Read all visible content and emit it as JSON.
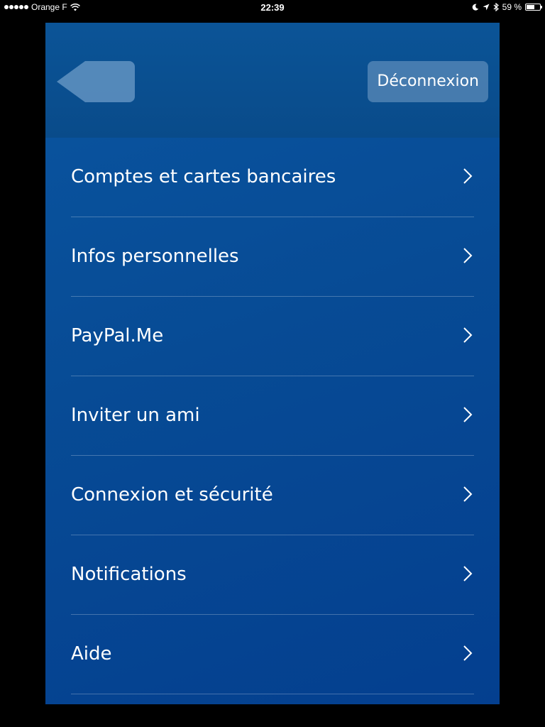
{
  "status_bar": {
    "carrier": "Orange F",
    "time": "22:39",
    "battery_text": "59 %",
    "battery_level": 0.59,
    "icons": [
      "signal-dots-icon",
      "wifi-icon",
      "moon-icon",
      "location-arrow-icon",
      "bluetooth-icon",
      "battery-icon"
    ]
  },
  "header": {
    "back_icon": "back-arrow-icon",
    "logout_label": "Déconnexion"
  },
  "menu": {
    "items": [
      {
        "label": "Comptes et cartes bancaires",
        "icon": "chevron-right-icon"
      },
      {
        "label": "Infos personnelles",
        "icon": "chevron-right-icon"
      },
      {
        "label": "PayPal.Me",
        "icon": "chevron-right-icon"
      },
      {
        "label": "Inviter un ami",
        "icon": "chevron-right-icon"
      },
      {
        "label": "Connexion et sécurité",
        "icon": "chevron-right-icon"
      },
      {
        "label": "Notifications",
        "icon": "chevron-right-icon"
      },
      {
        "label": "Aide",
        "icon": "chevron-right-icon"
      }
    ]
  },
  "colors": {
    "panel_top": "#0a55a0",
    "panel_bottom": "#043f8f",
    "button_bg": "#6e9cc8",
    "text": "#ffffff",
    "divider": "#5a86b8"
  }
}
